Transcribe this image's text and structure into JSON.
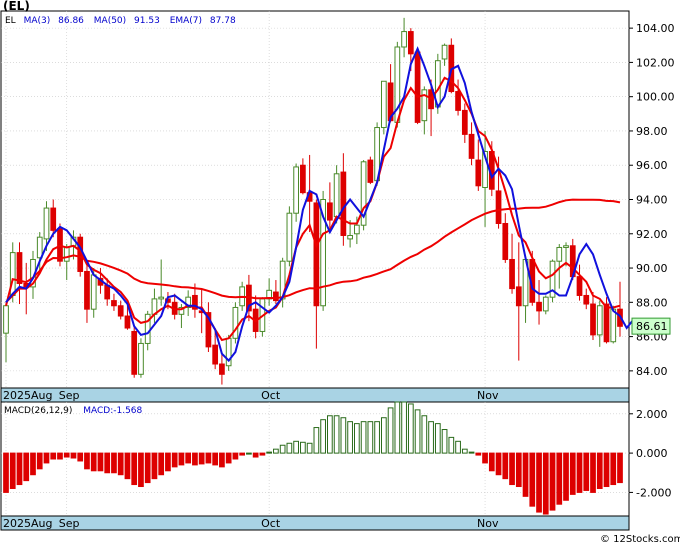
{
  "symbol": "(EL)",
  "watermark": "© 12Stocks.com",
  "chart_data": [
    {
      "type": "candlestick",
      "legend": [
        {
          "label": "EL",
          "color": "#000000"
        },
        {
          "label": "MA(3)",
          "color": "#0000cc"
        },
        {
          "label": "86.86",
          "color": "#0000cc"
        },
        {
          "label": "MA(50)",
          "color": "#0000cc"
        },
        {
          "label": "91.53",
          "color": "#0000cc"
        },
        {
          "label": "EMA(7)",
          "color": "#0000cc"
        },
        {
          "label": "87.78",
          "color": "#0000cc"
        }
      ],
      "last_price": "86.61",
      "ylim": [
        83,
        105
      ],
      "yticks": [
        "84.00",
        "86.00",
        "88.00",
        "90.00",
        "92.00",
        "94.00",
        "96.00",
        "98.00",
        "100.00",
        "102.00",
        "104.00"
      ],
      "ytick_values": [
        84,
        86,
        88,
        90,
        92,
        94,
        96,
        98,
        100,
        102,
        104
      ],
      "x_labels": [
        {
          "label": "2025Aug",
          "index": 0
        },
        {
          "label": "Sep",
          "index": 9
        },
        {
          "label": "Oct",
          "index": 39
        },
        {
          "label": "Nov",
          "index": 71
        }
      ],
      "colors": {
        "up": "#4a8a2a",
        "up_fill": "#ffffff",
        "down": "#dd0000",
        "ma3": "#1111dd",
        "ema7": "#ee0000",
        "ma50": "#1111dd"
      },
      "candles": [
        [
          86.2,
          88.0,
          84.5,
          87.8
        ],
        [
          88.4,
          91.5,
          88.0,
          90.9
        ],
        [
          90.9,
          91.5,
          87.9,
          89.1
        ],
        [
          89.1,
          90.3,
          87.3,
          88.9
        ],
        [
          88.9,
          91.0,
          88.2,
          90.5
        ],
        [
          90.6,
          92.1,
          89.8,
          91.8
        ],
        [
          91.7,
          93.9,
          91.0,
          93.5
        ],
        [
          93.5,
          94.0,
          91.8,
          92.2
        ],
        [
          92.3,
          92.6,
          90.1,
          90.4
        ],
        [
          90.4,
          91.4,
          89.3,
          91.2
        ],
        [
          91.3,
          92.2,
          90.5,
          91.8
        ],
        [
          91.8,
          92.0,
          89.5,
          89.8
        ],
        [
          89.8,
          90.2,
          86.8,
          87.6
        ],
        [
          87.6,
          90.0,
          87.1,
          89.6
        ],
        [
          89.4,
          90.0,
          88.5,
          89.0
        ],
        [
          89.0,
          89.4,
          87.8,
          88.2
        ],
        [
          88.1,
          88.5,
          87.5,
          87.8
        ],
        [
          87.8,
          88.1,
          87.0,
          87.2
        ],
        [
          87.2,
          87.9,
          86.4,
          86.5
        ],
        [
          86.3,
          86.6,
          83.6,
          83.8
        ],
        [
          83.8,
          85.9,
          83.6,
          85.6
        ],
        [
          85.6,
          87.5,
          85.2,
          87.3
        ],
        [
          87.3,
          88.8,
          86.8,
          88.2
        ],
        [
          88.2,
          90.5,
          87.8,
          88.3
        ],
        [
          88.2,
          88.6,
          87.6,
          88.0
        ],
        [
          88.0,
          88.5,
          87.0,
          87.3
        ],
        [
          87.3,
          87.9,
          86.5,
          87.7
        ],
        [
          87.7,
          88.7,
          87.2,
          88.3
        ],
        [
          88.4,
          89.1,
          87.1,
          87.6
        ],
        [
          87.5,
          88.8,
          86.2,
          87.4
        ],
        [
          87.4,
          88.0,
          85.1,
          85.4
        ],
        [
          85.5,
          86.5,
          84.1,
          84.4
        ],
        [
          84.4,
          85.0,
          83.2,
          83.8
        ],
        [
          84.3,
          86.1,
          84.0,
          85.9
        ],
        [
          85.9,
          88.0,
          85.6,
          87.7
        ],
        [
          87.8,
          89.2,
          87.5,
          88.9
        ],
        [
          89.0,
          89.6,
          86.9,
          87.5
        ],
        [
          87.6,
          88.4,
          85.9,
          86.3
        ],
        [
          86.3,
          88.3,
          86.0,
          88.2
        ],
        [
          88.2,
          89.4,
          87.8,
          88.7
        ],
        [
          88.6,
          89.3,
          87.9,
          88.1
        ],
        [
          88.2,
          90.6,
          87.7,
          90.4
        ],
        [
          90.4,
          93.6,
          90.1,
          93.2
        ],
        [
          93.2,
          96.1,
          92.7,
          95.9
        ],
        [
          96.0,
          96.4,
          94.3,
          94.4
        ],
        [
          94.4,
          96.6,
          92.1,
          93.9
        ],
        [
          93.8,
          94.0,
          85.3,
          87.8
        ],
        [
          87.8,
          94.5,
          87.5,
          94.0
        ],
        [
          93.8,
          95.0,
          92.2,
          92.8
        ],
        [
          93.0,
          96.0,
          92.6,
          95.5
        ],
        [
          95.6,
          96.7,
          91.3,
          91.9
        ],
        [
          91.7,
          92.8,
          91.2,
          91.9
        ],
        [
          92.0,
          93.0,
          91.4,
          92.5
        ],
        [
          92.5,
          96.3,
          92.2,
          96.2
        ],
        [
          96.3,
          96.5,
          94.9,
          95.0
        ],
        [
          95.1,
          98.5,
          94.8,
          98.2
        ],
        [
          98.2,
          100.9,
          97.8,
          100.9
        ],
        [
          100.8,
          101.9,
          98.5,
          98.6
        ],
        [
          98.5,
          103.2,
          98.2,
          102.9
        ],
        [
          102.9,
          104.6,
          102.3,
          103.8
        ],
        [
          103.8,
          104.0,
          101.5,
          102.5
        ],
        [
          102.6,
          102.7,
          98.4,
          98.5
        ],
        [
          98.6,
          100.6,
          97.8,
          100.4
        ],
        [
          100.4,
          101.0,
          97.7,
          99.3
        ],
        [
          99.4,
          102.5,
          99.0,
          102.1
        ],
        [
          102.2,
          103.1,
          101.8,
          103.0
        ],
        [
          103.0,
          103.4,
          100.2,
          100.3
        ],
        [
          100.3,
          101.0,
          98.9,
          99.2
        ],
        [
          99.2,
          99.6,
          97.3,
          97.8
        ],
        [
          97.8,
          98.5,
          96.0,
          96.4
        ],
        [
          96.3,
          97.5,
          94.5,
          94.8
        ],
        [
          94.7,
          98.0,
          92.4,
          96.8
        ],
        [
          96.8,
          97.4,
          94.2,
          94.6
        ],
        [
          94.5,
          96.5,
          92.3,
          92.6
        ],
        [
          92.6,
          93.2,
          90.3,
          90.5
        ],
        [
          90.5,
          92.0,
          88.5,
          88.8
        ],
        [
          88.9,
          91.5,
          84.6,
          87.8
        ],
        [
          87.8,
          90.7,
          86.8,
          90.5
        ],
        [
          90.5,
          91.0,
          87.8,
          88.0
        ],
        [
          88.0,
          89.3,
          86.7,
          87.5
        ],
        [
          87.5,
          88.4,
          87.3,
          88.3
        ],
        [
          88.3,
          90.5,
          88.0,
          90.4
        ],
        [
          90.4,
          91.4,
          88.8,
          91.2
        ],
        [
          91.2,
          91.5,
          90.1,
          91.3
        ],
        [
          91.3,
          91.7,
          89.3,
          89.5
        ],
        [
          89.5,
          90.2,
          88.1,
          88.4
        ],
        [
          88.4,
          88.8,
          87.6,
          87.9
        ],
        [
          87.9,
          88.6,
          85.8,
          86.1
        ],
        [
          86.1,
          88.1,
          85.4,
          87.8
        ],
        [
          87.9,
          88.3,
          85.6,
          85.7
        ],
        [
          85.7,
          87.8,
          85.6,
          87.6
        ],
        [
          87.6,
          89.2,
          86.0,
          86.6
        ]
      ],
      "ma3": [
        88.0,
        88.5,
        88.9,
        88.8,
        89.4,
        90.4,
        91.3,
        92.0,
        92.4,
        92.2,
        91.7,
        91.2,
        90.4,
        89.6,
        89.3,
        89.0,
        88.8,
        88.4,
        87.9,
        86.6,
        86.1,
        86.2,
        86.7,
        87.2,
        88.3,
        88.4,
        88.1,
        87.8,
        87.8,
        87.6,
        87.1,
        86.4,
        85.0,
        84.6,
        85.1,
        86.6,
        87.8,
        88.0,
        87.7,
        87.4,
        87.8,
        88.3,
        89.2,
        91.2,
        93.4,
        94.5,
        94.3,
        93.0,
        92.1,
        92.8,
        93.5,
        94.0,
        93.5,
        93.0,
        94.0,
        95.0,
        96.9,
        98.8,
        99.3,
        100.0,
        101.9,
        102.8,
        101.8,
        100.7,
        99.4,
        100.0,
        101.6,
        101.8,
        100.8,
        99.1,
        97.8,
        96.5,
        95.3,
        95.8,
        95.4,
        94.6,
        92.5,
        90.6,
        88.8,
        88.5,
        88.5,
        88.7,
        88.4,
        88.4,
        89.5,
        90.8,
        91.4,
        90.8,
        89.6,
        88.5,
        87.5,
        87.2,
        86.5,
        87.0,
        86.8
      ],
      "ema7": [
        88.0,
        88.4,
        88.8,
        88.8,
        89.1,
        89.7,
        90.5,
        91.1,
        91.3,
        91.2,
        91.3,
        91.0,
        90.2,
        89.9,
        89.7,
        89.3,
        88.9,
        88.6,
        88.1,
        87.1,
        86.8,
        86.9,
        87.3,
        87.6,
        87.8,
        87.6,
        87.6,
        87.8,
        87.7,
        87.7,
        87.1,
        86.4,
        85.8,
        85.9,
        86.4,
        87.0,
        87.2,
        86.9,
        87.2,
        87.5,
        87.7,
        88.3,
        89.6,
        91.2,
        92.0,
        92.5,
        91.3,
        92.0,
        92.2,
        93.0,
        92.8,
        92.6,
        92.6,
        93.5,
        93.9,
        95.0,
        96.5,
        97.0,
        98.5,
        99.8,
        100.5,
        100.0,
        100.1,
        99.9,
        100.4,
        101.1,
        100.9,
        100.5,
        99.8,
        99.0,
        98.0,
        97.7,
        96.9,
        95.8,
        94.5,
        93.1,
        91.9,
        91.5,
        90.6,
        89.8,
        89.4,
        89.6,
        90.0,
        90.3,
        90.0,
        89.6,
        89.2,
        88.4,
        88.2,
        87.7,
        87.7,
        87.8
      ]
    },
    {
      "type": "bar",
      "title": "MACD(26,12,9)",
      "value_label": "MACD:-1.568",
      "ylim": [
        -3.2,
        2.6
      ],
      "yticks": [
        "-2.000",
        "0.000",
        "2.000"
      ],
      "ytick_values": [
        -2,
        0,
        2
      ],
      "x_labels": [
        {
          "label": "2025Aug",
          "index": 0
        },
        {
          "label": "Sep",
          "index": 9
        },
        {
          "label": "Oct",
          "index": 39
        },
        {
          "label": "Nov",
          "index": 71
        }
      ],
      "colors": {
        "positive": "#2a6a1a",
        "negative": "#dd0000"
      },
      "values": [
        -2.0,
        -1.8,
        -1.6,
        -1.4,
        -1.1,
        -0.8,
        -0.5,
        -0.3,
        -0.3,
        -0.2,
        -0.25,
        -0.4,
        -0.8,
        -0.9,
        -0.9,
        -1.0,
        -1.0,
        -1.1,
        -1.3,
        -1.6,
        -1.7,
        -1.5,
        -1.3,
        -1.1,
        -0.9,
        -0.7,
        -0.6,
        -0.5,
        -0.6,
        -0.55,
        -0.5,
        -0.6,
        -0.7,
        -0.5,
        -0.3,
        -0.1,
        0.0,
        -0.2,
        -0.1,
        0.05,
        0.2,
        0.4,
        0.5,
        0.6,
        0.55,
        0.5,
        1.3,
        1.7,
        1.9,
        1.9,
        1.8,
        1.6,
        1.5,
        1.6,
        1.6,
        1.6,
        1.8,
        2.3,
        2.6,
        2.6,
        2.5,
        2.2,
        1.9,
        1.6,
        1.5,
        1.2,
        0.8,
        0.6,
        0.2,
        0.05,
        -0.1,
        -0.5,
        -0.9,
        -1.1,
        -1.3,
        -1.6,
        -1.7,
        -2.2,
        -2.7,
        -3.0,
        -3.1,
        -2.9,
        -2.6,
        -2.4,
        -2.1,
        -2.0,
        -1.9,
        -2.0,
        -1.8,
        -1.7,
        -1.6,
        -1.5
      ]
    }
  ]
}
